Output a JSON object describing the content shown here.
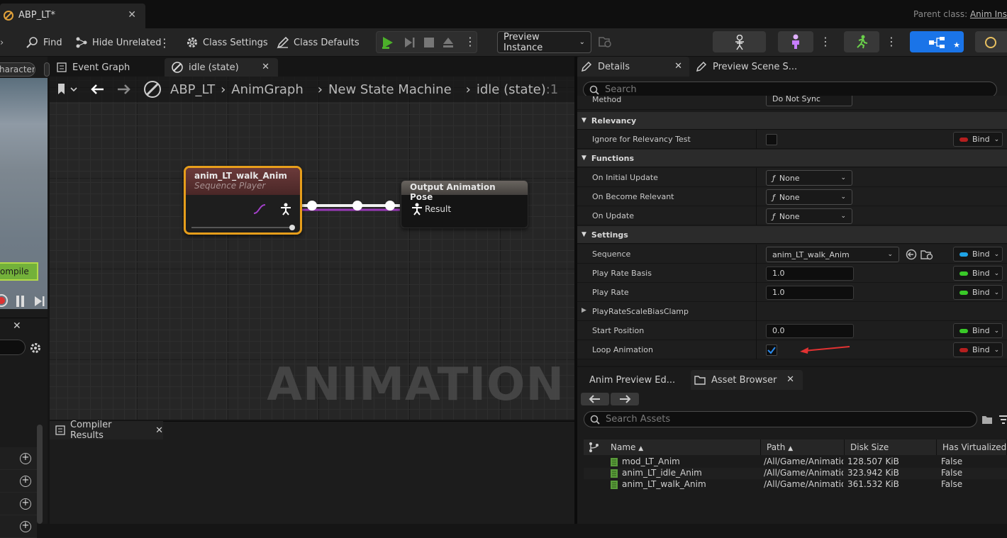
{
  "window": {
    "tab_title": "ABP_LT*",
    "parent_class_label": "Parent class:",
    "parent_class_value": "Anim Ins"
  },
  "toolbar": {
    "find": "Find",
    "hide_unrelated": "Hide Unrelated",
    "class_settings": "Class Settings",
    "class_defaults": "Class Defaults",
    "preview_instance": "Preview Instance"
  },
  "left": {
    "character_chip": "haracter",
    "compile_chip": "ompile"
  },
  "graph": {
    "tabs": [
      {
        "label": "Event Graph"
      },
      {
        "label": "idle (state)"
      }
    ],
    "breadcrumb": [
      "ABP_LT",
      "AnimGraph",
      "New State Machine",
      "idle (state)"
    ],
    "breadcrumb_trail": ":1",
    "watermark": "ANIMATION",
    "seq_node": {
      "title": "anim_LT_walk_Anim",
      "subtitle": "Sequence Player"
    },
    "out_node": {
      "title": "Output Animation Pose",
      "pin": "Result"
    }
  },
  "compiler": {
    "tab": "Compiler Results"
  },
  "details": {
    "tabs": [
      {
        "label": "Details"
      },
      {
        "label": "Preview Scene S..."
      }
    ],
    "search_placeholder": "Search",
    "cropped_row": {
      "label": "Method",
      "value": "Do Not Sync"
    },
    "categories": {
      "relevancy": "Relevancy",
      "functions": "Functions",
      "settings": "Settings"
    },
    "rows": {
      "ignore_relevancy": "Ignore for Relevancy Test",
      "on_initial_update": "On Initial Update",
      "on_become_relevant": "On Become Relevant",
      "on_update": "On Update",
      "sequence": "Sequence",
      "play_rate_basis": "Play Rate Basis",
      "play_rate": "Play Rate",
      "play_rate_clamp": "PlayRateScaleBiasClamp",
      "start_position": "Start Position",
      "loop_animation": "Loop Animation"
    },
    "values": {
      "fn_none": "None",
      "sequence": "anim_LT_walk_Anim",
      "play_rate_basis": "1.0",
      "play_rate": "1.0",
      "start_position": "0.0",
      "loop_checked": true
    },
    "bind_label": "Bind",
    "bind_colors": {
      "bool": "#b51f1f",
      "object": "#1fa3e6",
      "float": "#39c928"
    }
  },
  "asset_browser": {
    "tabs": [
      {
        "label": "Anim Preview Ed..."
      },
      {
        "label": "Asset Browser"
      }
    ],
    "search_placeholder": "Search Assets",
    "columns": [
      "Name",
      "Path",
      "Disk Size",
      "Has Virtualized D"
    ],
    "rows": [
      {
        "name": "mod_LT_Anim",
        "path": "/All/Game/Animatio",
        "size": "128.507 KiB",
        "virt": "False"
      },
      {
        "name": "anim_LT_idle_Anim",
        "path": "/All/Game/Animatio",
        "size": "323.942 KiB",
        "virt": "False"
      },
      {
        "name": "anim_LT_walk_Anim",
        "path": "/All/Game/Animatio",
        "size": "361.532 KiB",
        "virt": "False"
      }
    ]
  }
}
